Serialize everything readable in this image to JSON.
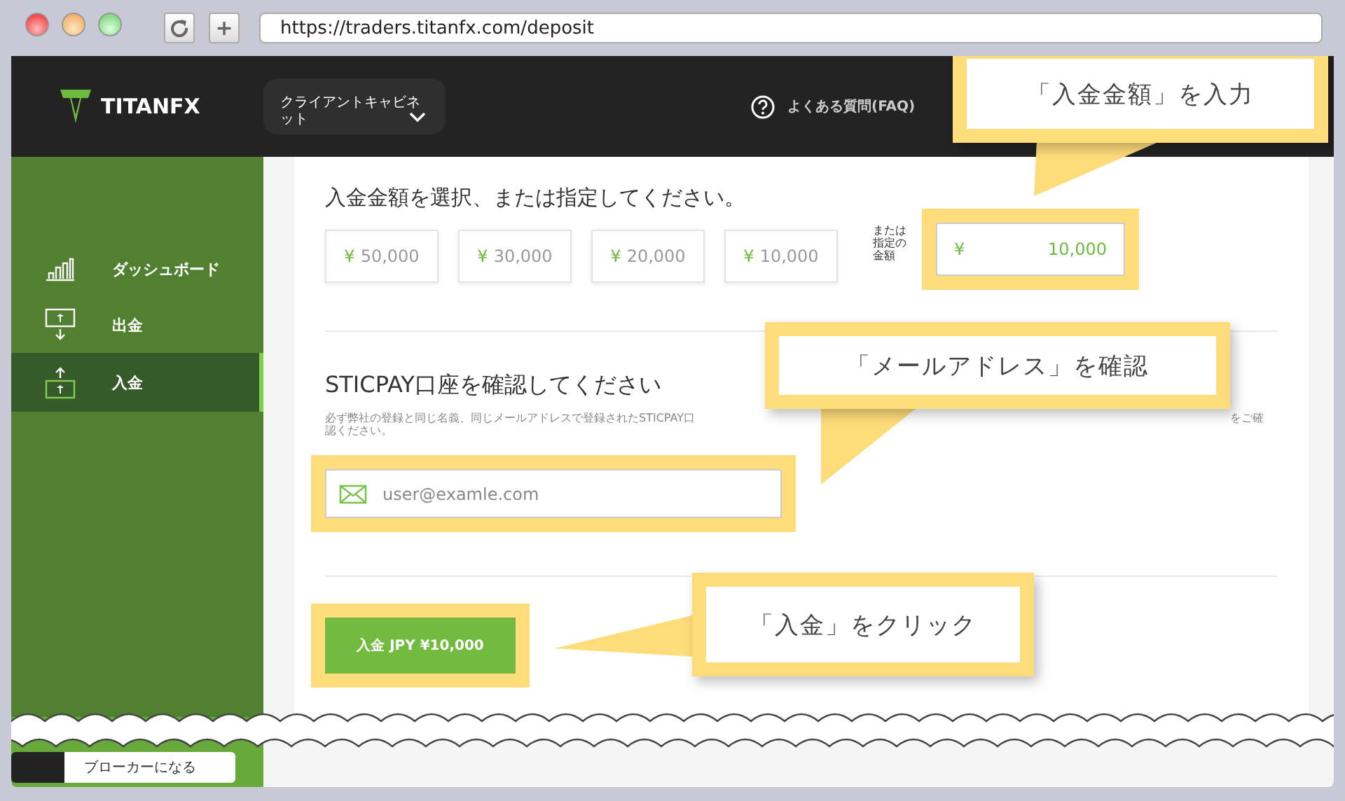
{
  "browser": {
    "new_tab_button": "+",
    "url": "https://traders.titanfx.com/deposit"
  },
  "header": {
    "logo": "TITANFX",
    "menu": "クライアントキャビネット",
    "faq": "よくある質問(FAQ)"
  },
  "sidebar": {
    "items": [
      {
        "label": "ダッシュボード",
        "kind": "dashboard",
        "selected": false
      },
      {
        "label": "出金",
        "kind": "withdraw",
        "selected": false
      },
      {
        "label": "入金",
        "kind": "deposit",
        "selected": true
      }
    ],
    "footer_button": "ブローカーになる"
  },
  "amount": {
    "heading": "入金金額を選択、または指定してください。",
    "presets": [
      {
        "currency": "¥",
        "amount": "50,000"
      },
      {
        "currency": "¥",
        "amount": "30,000"
      },
      {
        "currency": "¥",
        "amount": "20,000"
      },
      {
        "currency": "¥",
        "amount": "10,000"
      }
    ],
    "custom_label": "または指定の金額",
    "custom_currency": "¥",
    "custom_value": "10,000",
    "highlighted": true
  },
  "sticpay": {
    "heading": "STICPAY口座を確認してください",
    "note_start": "必ず弊社の登録と同じ名義、同じメールアドレスで登録されたSTICPAY口",
    "note_end": "をご確",
    "note_line2": "認ください。",
    "email_placeholder": "user@examle.com",
    "highlighted": true
  },
  "submit": {
    "label": "入金 JPY ¥10,000",
    "highlighted": true
  },
  "callouts": [
    {
      "text": "「入金金額」を入力"
    },
    {
      "text": "「メールアドレス」を確認"
    },
    {
      "text": "「入金」をクリック"
    }
  ]
}
